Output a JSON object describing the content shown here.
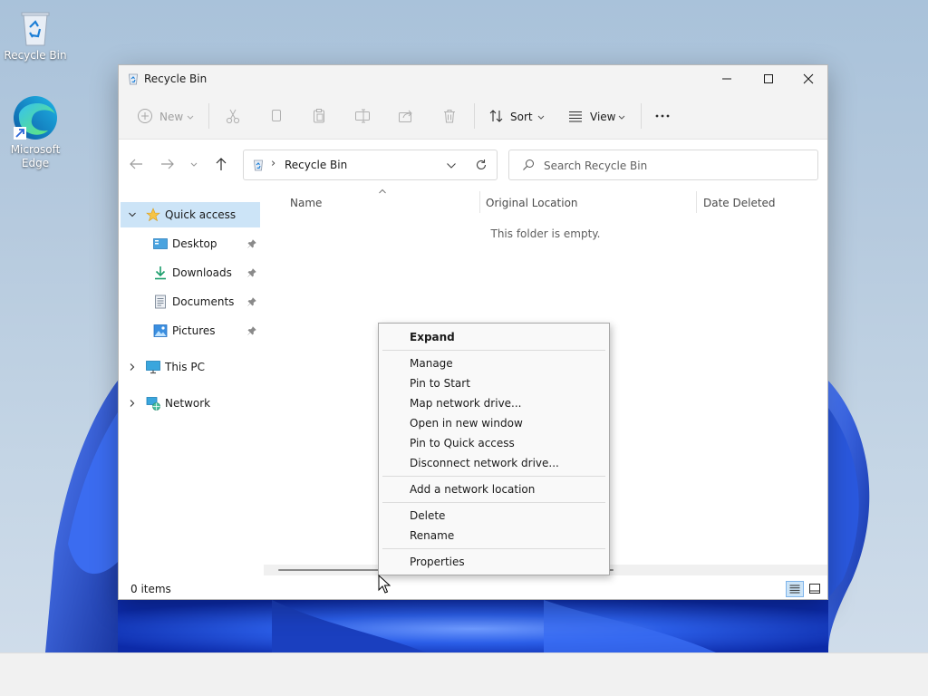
{
  "desktop": {
    "icons": [
      {
        "label": "Recycle Bin"
      },
      {
        "label": "Microsoft Edge"
      }
    ]
  },
  "window": {
    "title": "Recycle Bin",
    "toolbar": {
      "new_label": "New",
      "sort_label": "Sort",
      "view_label": "View"
    },
    "address": {
      "separator": "›",
      "path": "Recycle Bin"
    },
    "search": {
      "placeholder": "Search Recycle Bin",
      "value": ""
    },
    "nav_pane": {
      "items": [
        {
          "label": "Quick access",
          "icon": "star-icon"
        },
        {
          "label": "Desktop",
          "icon": "desktop-icon"
        },
        {
          "label": "Downloads",
          "icon": "download-icon"
        },
        {
          "label": "Documents",
          "icon": "document-icon"
        },
        {
          "label": "Pictures",
          "icon": "picture-icon"
        },
        {
          "label": "This PC",
          "icon": "computer-icon"
        },
        {
          "label": "Network",
          "icon": "network-icon"
        }
      ]
    },
    "content": {
      "columns": [
        "Name",
        "Original Location",
        "Date Deleted"
      ],
      "empty_message": "This folder is empty."
    },
    "status": {
      "item_count": "0 items"
    }
  },
  "context_menu": {
    "items": [
      "Expand",
      "Manage",
      "Pin to Start",
      "Map network drive...",
      "Open in new window",
      "Pin to Quick access",
      "Disconnect network drive...",
      "Add a network location",
      "Delete",
      "Rename",
      "Properties"
    ]
  },
  "colors": {
    "selection": "#cce4f7",
    "accent": "#0067c0",
    "wallpaper_blue": "#1f4fd1"
  }
}
